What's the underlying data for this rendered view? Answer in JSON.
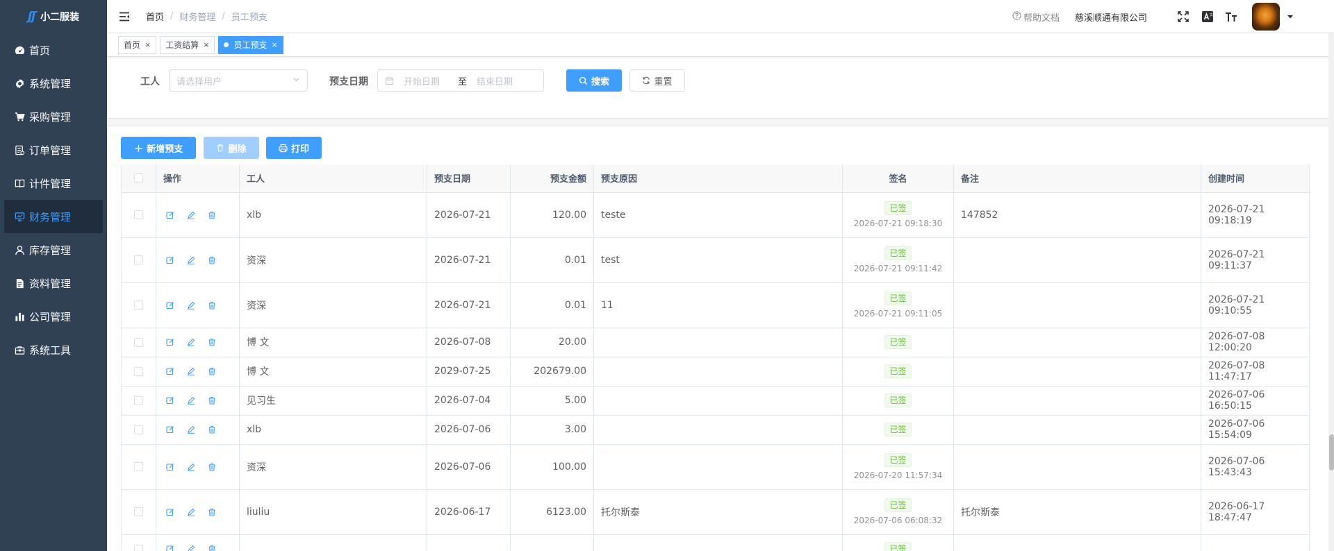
{
  "sidebar": {
    "logo_text": "小二服装",
    "items": [
      {
        "label": "首页",
        "icon": "dashboard-icon"
      },
      {
        "label": "系统管理",
        "icon": "gear-icon"
      },
      {
        "label": "采购管理",
        "icon": "cart-icon"
      },
      {
        "label": "订单管理",
        "icon": "order-icon"
      },
      {
        "label": "计件管理",
        "icon": "book-icon"
      },
      {
        "label": "财务管理",
        "icon": "monitor-icon",
        "active": true
      },
      {
        "label": "库存管理",
        "icon": "user-icon"
      },
      {
        "label": "资料管理",
        "icon": "document-icon"
      },
      {
        "label": "公司管理",
        "icon": "bar-chart-icon"
      },
      {
        "label": "系统工具",
        "icon": "toolbox-icon"
      }
    ]
  },
  "header": {
    "breadcrumb": [
      "首页",
      "财务管理",
      "员工预支"
    ],
    "help_text": "帮助文档",
    "company_name": "慈溪顺通有限公司"
  },
  "tags": [
    {
      "label": "首页"
    },
    {
      "label": "工资结算"
    },
    {
      "label": "员工预支",
      "active": true
    }
  ],
  "search": {
    "worker_label": "工人",
    "worker_placeholder": "请选择用户",
    "date_label": "预支日期",
    "start_placeholder": "开始日期",
    "range_separator": "至",
    "end_placeholder": "结束日期",
    "search_button": "搜索",
    "reset_button": "重置"
  },
  "toolbar": {
    "add_button": "新增预支",
    "delete_button": "删除",
    "print_button": "打印"
  },
  "table": {
    "columns": [
      "操作",
      "工人",
      "预支日期",
      "预支金额",
      "预支原因",
      "签名",
      "备注",
      "创建时间"
    ],
    "rows": [
      {
        "worker": "xlb",
        "date": "2026-07-21",
        "amount": "120.00",
        "reason": "teste",
        "sign": "已签",
        "sign_time": "2026-07-21 09:18:30",
        "remark": "147852",
        "created": "2026-07-21 09:18:19"
      },
      {
        "worker": "资深",
        "date": "2026-07-21",
        "amount": "0.01",
        "reason": "test",
        "sign": "已签",
        "sign_time": "2026-07-21 09:11:42",
        "remark": "",
        "created": "2026-07-21 09:11:37"
      },
      {
        "worker": "资深",
        "date": "2026-07-21",
        "amount": "0.01",
        "reason": "11",
        "sign": "已签",
        "sign_time": "2026-07-21 09:11:05",
        "remark": "",
        "created": "2026-07-21 09:10:55"
      },
      {
        "worker": "博 文",
        "date": "2026-07-08",
        "amount": "20.00",
        "reason": "",
        "sign": "已签",
        "sign_time": "",
        "remark": "",
        "created": "2026-07-08 12:00:20"
      },
      {
        "worker": "博 文",
        "date": "2029-07-25",
        "amount": "202679.00",
        "reason": "",
        "sign": "已签",
        "sign_time": "",
        "remark": "",
        "created": "2026-07-08 11:47:17"
      },
      {
        "worker": "见习生",
        "date": "2026-07-04",
        "amount": "5.00",
        "reason": "",
        "sign": "已签",
        "sign_time": "",
        "remark": "",
        "created": "2026-07-06 16:50:15"
      },
      {
        "worker": "xlb",
        "date": "2026-07-06",
        "amount": "3.00",
        "reason": "",
        "sign": "已签",
        "sign_time": "",
        "remark": "",
        "created": "2026-07-06 15:54:09"
      },
      {
        "worker": "资深",
        "date": "2026-07-06",
        "amount": "100.00",
        "reason": "",
        "sign": "已签",
        "sign_time": "2026-07-20 11:57:34",
        "remark": "",
        "created": "2026-07-06 15:43:43"
      },
      {
        "worker": "liuliu",
        "date": "2026-06-17",
        "amount": "6123.00",
        "reason": "托尔斯泰",
        "sign": "已签",
        "sign_time": "2026-07-06 06:08:32",
        "remark": "托尔斯泰",
        "created": "2026-06-17 18:47:47"
      },
      {
        "worker": "",
        "date": "",
        "amount": "",
        "reason": "",
        "sign": "已签",
        "sign_time": "",
        "remark": "",
        "created": ""
      }
    ]
  },
  "colors": {
    "sidebar_bg": "#304156",
    "primary": "#409eff",
    "success": "#67c23a"
  }
}
